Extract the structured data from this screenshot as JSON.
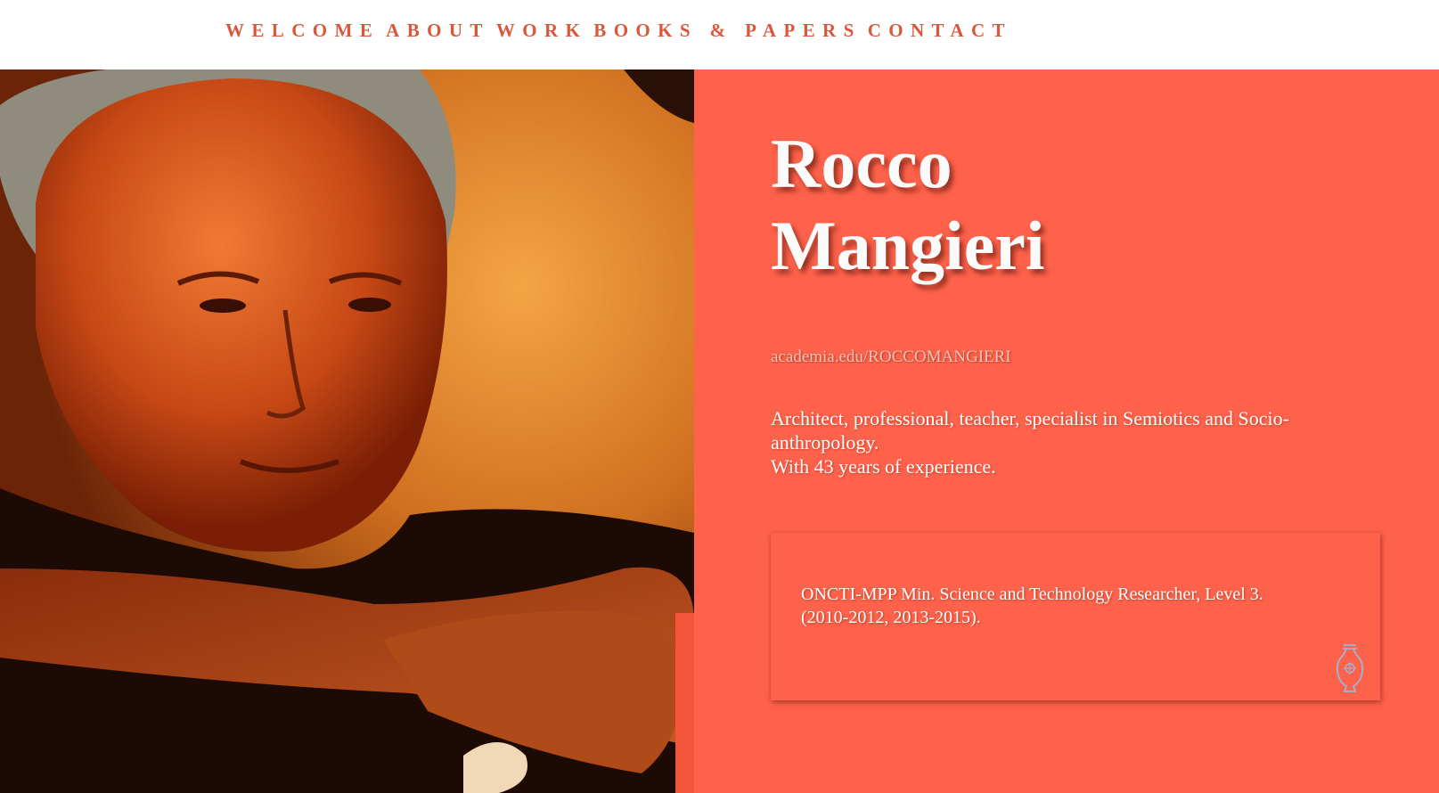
{
  "nav": {
    "items": [
      "WELCOME",
      "ABOUT",
      "WORK",
      "BOOKS & PAPERS",
      "CONTACT"
    ]
  },
  "profile": {
    "first_name": "Rocco",
    "last_name": "Mangieri",
    "link_text": "academia.edu/ROCCOMANGIERI",
    "bio_line1": "Architect, professional, teacher, specialist in Semiotics and Socio-anthropology.",
    "bio_line2": "With 43 years of experience."
  },
  "card": {
    "line1": "ONCTI-MPP Min. Science and Technology Researcher, Level 3.",
    "line2": "(2010-2012, 2013-2015).",
    "icon": "vase-icon"
  },
  "colors": {
    "accent": "#ff624a",
    "nav_text": "#d9573a",
    "heading_text": "#fbfbfb"
  }
}
